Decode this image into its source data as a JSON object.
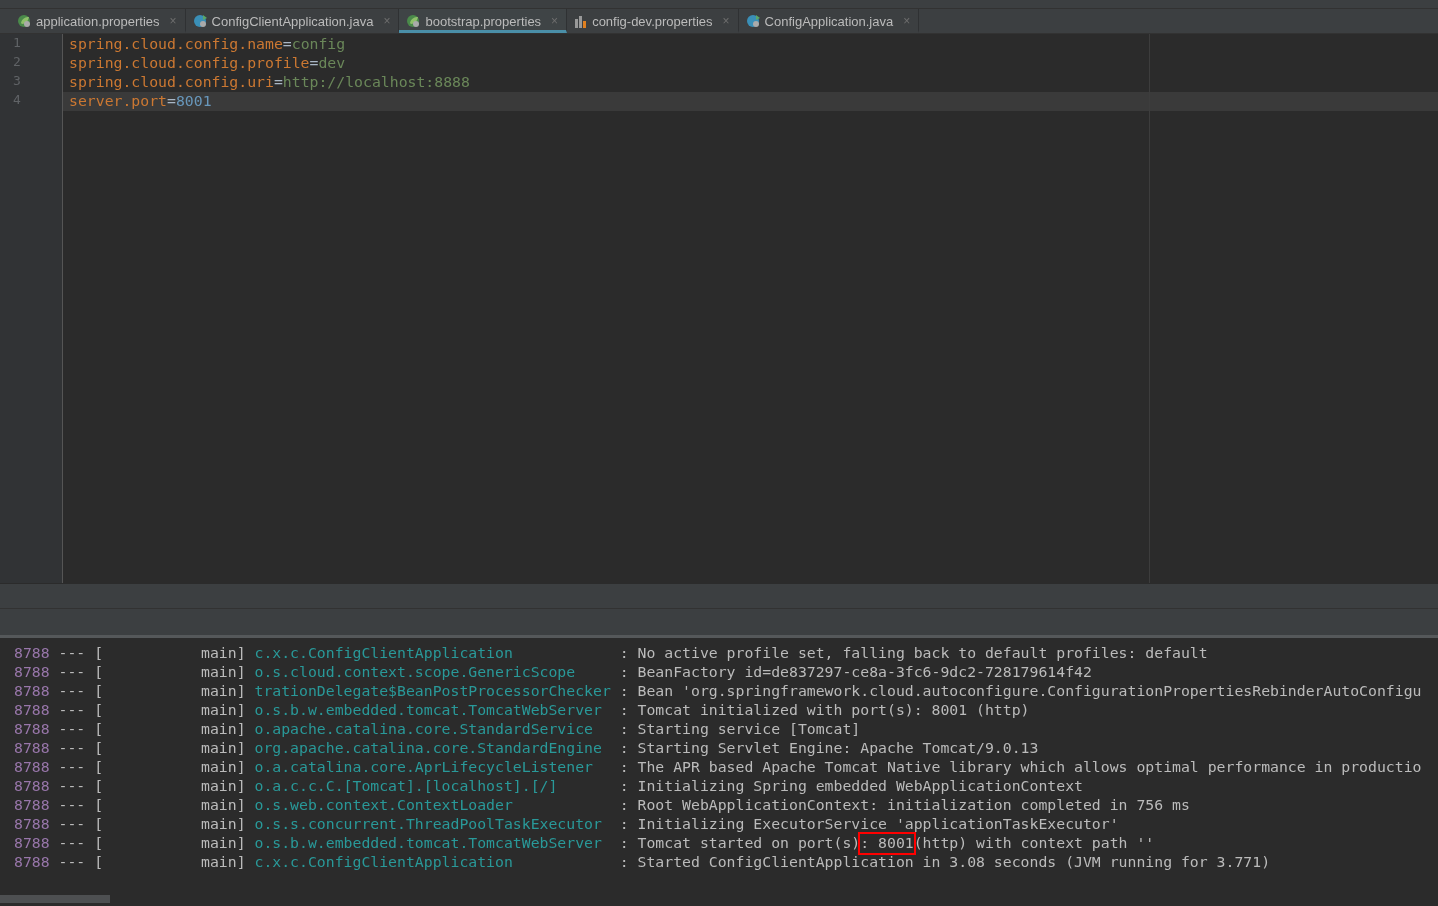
{
  "tabs": [
    {
      "label": "application.properties",
      "kind": "spring",
      "close": "×",
      "selected": false
    },
    {
      "label": "ConfigClientApplication.java",
      "kind": "java",
      "close": "×",
      "selected": false
    },
    {
      "label": "bootstrap.properties",
      "kind": "spring",
      "close": "×",
      "selected": true
    },
    {
      "label": "config-dev.properties",
      "kind": "properties",
      "close": "×",
      "selected": false
    },
    {
      "label": "ConfigApplication.java",
      "kind": "java",
      "close": "×",
      "selected": false
    }
  ],
  "editor": {
    "lines": [
      {
        "number": "1",
        "key": "spring.cloud.config.name",
        "operator": "=",
        "value": "config",
        "kind": "string",
        "current": false
      },
      {
        "number": "2",
        "key": "spring.cloud.config.profile",
        "operator": "=",
        "value": "dev",
        "kind": "string",
        "current": false
      },
      {
        "number": "3",
        "key": "spring.cloud.config.uri",
        "operator": "=",
        "value": "http://localhost:8888",
        "kind": "string",
        "current": false
      },
      {
        "number": "4",
        "key": "server.port",
        "operator": "=",
        "value": "8001",
        "kind": "number",
        "current": true
      }
    ]
  },
  "console": {
    "rows": [
      {
        "pid": "8788",
        "separator": "---",
        "bracket": "[",
        "thread": "main]",
        "logger": "c.x.c.ConfigClientApplication",
        "message": [
          {
            "text": ": No active profile set, falling back to default profiles: default",
            "boxed": false
          }
        ]
      },
      {
        "pid": "8788",
        "separator": "---",
        "bracket": "[",
        "thread": "main]",
        "logger": "o.s.cloud.context.scope.GenericScope",
        "message": [
          {
            "text": ": BeanFactory id=de837297-ce8a-3fc6-9dc2-728179614f42",
            "boxed": false
          }
        ]
      },
      {
        "pid": "8788",
        "separator": "---",
        "bracket": "[",
        "thread": "main]",
        "logger": "trationDelegate$BeanPostProcessorChecker",
        "message": [
          {
            "text": ": Bean 'org.springframework.cloud.autoconfigure.ConfigurationPropertiesRebinderAutoConfigu",
            "boxed": false
          }
        ]
      },
      {
        "pid": "8788",
        "separator": "---",
        "bracket": "[",
        "thread": "main]",
        "logger": "o.s.b.w.embedded.tomcat.TomcatWebServer",
        "message": [
          {
            "text": ": Tomcat initialized with port(s): 8001 (http)",
            "boxed": false
          }
        ]
      },
      {
        "pid": "8788",
        "separator": "---",
        "bracket": "[",
        "thread": "main]",
        "logger": "o.apache.catalina.core.StandardService",
        "message": [
          {
            "text": ": Starting service [Tomcat]",
            "boxed": false
          }
        ]
      },
      {
        "pid": "8788",
        "separator": "---",
        "bracket": "[",
        "thread": "main]",
        "logger": "org.apache.catalina.core.StandardEngine",
        "message": [
          {
            "text": ": Starting Servlet Engine: Apache Tomcat/9.0.13",
            "boxed": false
          }
        ]
      },
      {
        "pid": "8788",
        "separator": "---",
        "bracket": "[",
        "thread": "main]",
        "logger": "o.a.catalina.core.AprLifecycleListener",
        "message": [
          {
            "text": ": The APR based Apache Tomcat Native library which allows optimal performance in productio",
            "boxed": false
          }
        ]
      },
      {
        "pid": "8788",
        "separator": "---",
        "bracket": "[",
        "thread": "main]",
        "logger": "o.a.c.c.C.[Tomcat].[localhost].[/]",
        "message": [
          {
            "text": ": Initializing Spring embedded WebApplicationContext",
            "boxed": false
          }
        ]
      },
      {
        "pid": "8788",
        "separator": "---",
        "bracket": "[",
        "thread": "main]",
        "logger": "o.s.web.context.ContextLoader",
        "message": [
          {
            "text": ": Root WebApplicationContext: initialization completed in 756 ms",
            "boxed": false
          }
        ]
      },
      {
        "pid": "8788",
        "separator": "---",
        "bracket": "[",
        "thread": "main]",
        "logger": "o.s.s.concurrent.ThreadPoolTaskExecutor",
        "message": [
          {
            "text": ": Initializing ExecutorService 'applicationTaskExecutor'",
            "boxed": false
          }
        ]
      },
      {
        "pid": "8788",
        "separator": "---",
        "bracket": "[",
        "thread": "main]",
        "logger": "o.s.b.w.embedded.tomcat.TomcatWebServer",
        "message": [
          {
            "text": ": Tomcat started on port(s)",
            "boxed": false
          },
          {
            "text": ": 8001",
            "boxed": true
          },
          {
            "text": "(http) with context path ''",
            "boxed": false
          }
        ]
      },
      {
        "pid": "8788",
        "separator": "---",
        "bracket": "[",
        "thread": "main]",
        "logger": "c.x.c.ConfigClientApplication",
        "message": [
          {
            "text": ": Started ConfigClientApplication in 3.08 seconds (JVM running for 3.771)",
            "boxed": false
          }
        ]
      }
    ]
  }
}
